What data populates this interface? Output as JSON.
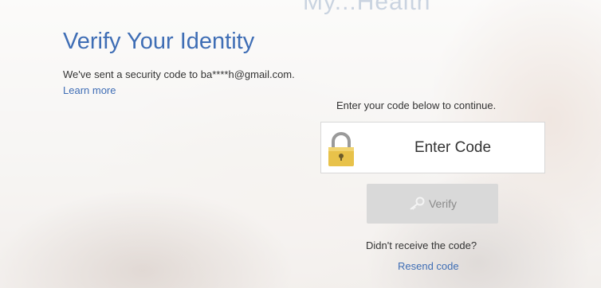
{
  "header": {
    "partial_brand": "My...Health"
  },
  "page": {
    "title": "Verify Your Identity",
    "sent_message": "We've sent a security code to ba****h@gmail.com.",
    "learn_more": "Learn more",
    "instruction": "Enter your code below to continue."
  },
  "code_field": {
    "placeholder": "Enter Code",
    "value": "",
    "icon": "lock-icon"
  },
  "verify_button": {
    "label": "Verify",
    "icon": "key-icon",
    "disabled": true
  },
  "resend": {
    "prompt": "Didn't receive the code?",
    "link": "Resend code"
  },
  "colors": {
    "link_blue": "#3f6eb5",
    "lock_gold": "#e8c24a",
    "button_disabled": "#d9d9d9"
  }
}
